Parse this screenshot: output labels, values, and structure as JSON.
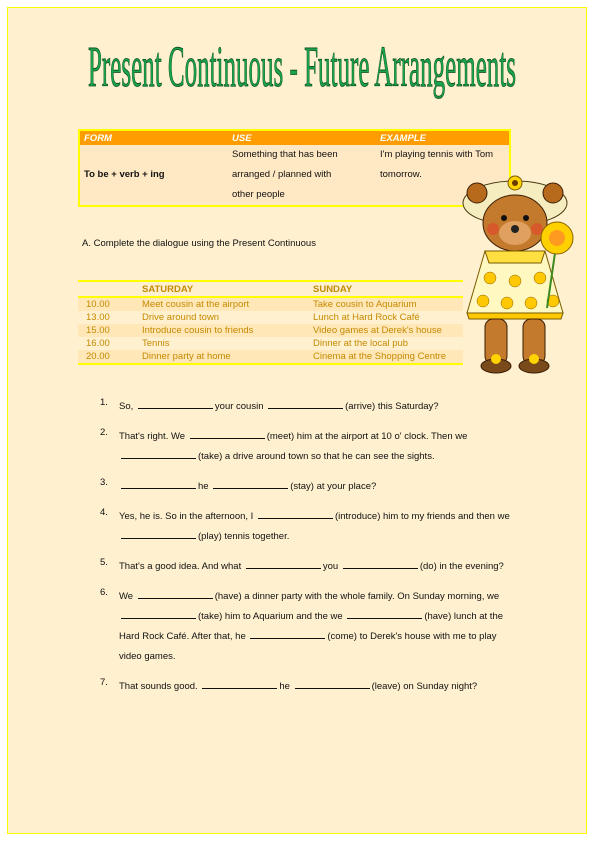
{
  "title": "Present Continuous - Future Arrangements",
  "colors": {
    "title_fill": "#1aa34a",
    "header_bg": "#ff9d00",
    "border": "#ffff00",
    "page_bg": "#fff0cf",
    "schedule_text": "#c58a00"
  },
  "form_table": {
    "headers": [
      "FORM",
      "USE",
      "EXAMPLE"
    ],
    "form": "To be + verb + ing",
    "use_lines": [
      "Something that has been",
      "arranged / planned with",
      "other people"
    ],
    "example_lines": [
      "I'm playing tennis with Tom",
      "tomorrow."
    ]
  },
  "instruction": "A. Complete the dialogue using the Present Continuous",
  "schedule": {
    "headers": [
      "",
      "SATURDAY",
      "SUNDAY"
    ],
    "rows": [
      {
        "time": "10.00",
        "saturday": "Meet cousin at the airport",
        "sunday": "Take cousin to Aquarium"
      },
      {
        "time": "13.00",
        "saturday": "Drive around town",
        "sunday": "Lunch at Hard Rock Café"
      },
      {
        "time": "15.00",
        "saturday": "Introduce cousin to friends",
        "sunday": "Video games at Derek's house"
      },
      {
        "time": "16.00",
        "saturday": "Tennis",
        "sunday": "Dinner at the local pub"
      },
      {
        "time": "20.00",
        "saturday": "Dinner party at home",
        "sunday": "Cinema at the Shopping Centre"
      }
    ]
  },
  "image": {
    "icon": "teddy-bear-with-sunflower"
  },
  "questions": [
    {
      "num": "1.",
      "parts": [
        "So,",
        null,
        "your cousin",
        null,
        "(arrive) this Saturday?"
      ]
    },
    {
      "num": "2.",
      "parts": [
        "That's right. We",
        null,
        "(meet) him at the airport at 10 o' clock. Then we",
        null,
        "(take) a drive around town so that he can see the sights."
      ]
    },
    {
      "num": "3.",
      "parts": [
        null,
        "he",
        null,
        "(stay) at your place?"
      ]
    },
    {
      "num": "4.",
      "parts": [
        "Yes, he is. So in the afternoon, I",
        null,
        "(introduce) him to my friends and then we",
        null,
        "(play) tennis together."
      ]
    },
    {
      "num": "5.",
      "parts": [
        "That's a good idea.  And what",
        null,
        "you",
        null,
        "(do) in the evening?"
      ]
    },
    {
      "num": "6.",
      "parts": [
        "We",
        null,
        "(have) a dinner party with the whole family. On Sunday morning, we",
        null,
        "(take) him to Aquarium and the we",
        null,
        "(have) lunch at the Hard Rock Café. After that, he",
        null,
        "(come) to Derek's house with me to play video games."
      ]
    },
    {
      "num": "7.",
      "parts": [
        "That sounds good.",
        null,
        "he",
        null,
        "(leave) on Sunday night?"
      ]
    }
  ]
}
